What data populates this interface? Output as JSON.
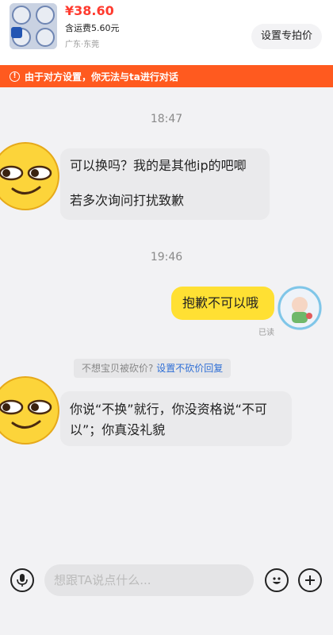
{
  "product": {
    "price": "¥38.60",
    "shipping": "含运费5.60元",
    "location": "广东·东莞",
    "special_button": "设置专拍价"
  },
  "notice": {
    "icon": "warning-icon",
    "text": "由于对方设置，你无法与ta进行对话"
  },
  "messages": {
    "time_1": "18:47",
    "msg_1_line1": "可以换吗？我的是其他ip的吧唧",
    "msg_1_line2": "若多次询问打扰致歉",
    "time_2": "19:46",
    "msg_2": "抱歉不可以哦",
    "read_status": "已读",
    "tip_text": "不想宝贝被砍价?",
    "tip_link": "设置不砍价回复",
    "msg_3_line1": "你说“不换”就行，你没资格说“不可",
    "msg_3_line2": "以”；你真没礼貌"
  },
  "input": {
    "placeholder": "想跟TA说点什么..."
  },
  "icons": {
    "voice": "microphone-icon",
    "emoji": "emoji-icon",
    "plus": "plus-icon"
  },
  "colors": {
    "price": "#ff3b2f",
    "notice_bg": "#ff5a1f",
    "outgoing_bubble": "#ffe033",
    "link": "#2f6fd6"
  }
}
